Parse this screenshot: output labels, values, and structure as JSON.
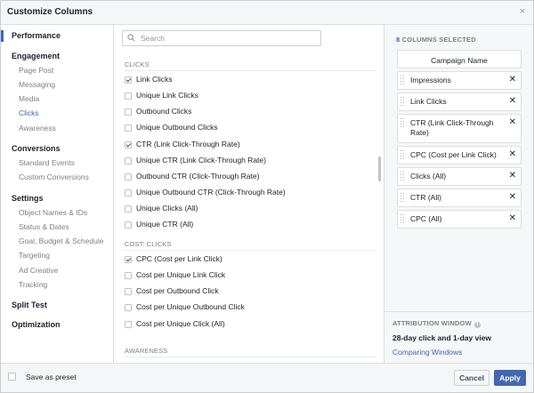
{
  "dialog": {
    "title": "Customize Columns",
    "close_glyph": "×"
  },
  "nav": {
    "sections": [
      {
        "label": "Performance",
        "items": []
      },
      {
        "label": "Engagement",
        "items": [
          "Page Post",
          "Messaging",
          "Media",
          "Clicks",
          "Awareness"
        ]
      },
      {
        "label": "Conversions",
        "items": [
          "Standard Events",
          "Custom Conversions"
        ]
      },
      {
        "label": "Settings",
        "items": [
          "Object Names & IDs",
          "Status & Dates",
          "Goal, Budget & Schedule",
          "Targeting",
          "Ad Creative",
          "Tracking"
        ]
      },
      {
        "label": "Split Test",
        "items": []
      },
      {
        "label": "Optimization",
        "items": []
      }
    ],
    "active_section": "Performance",
    "active_item": "Clicks"
  },
  "search": {
    "placeholder": "Search",
    "value": ""
  },
  "groups": [
    {
      "label": "CLICKS",
      "options": [
        {
          "label": "Link Clicks",
          "checked": true
        },
        {
          "label": "Unique Link Clicks",
          "checked": false
        },
        {
          "label": "Outbound Clicks",
          "checked": false
        },
        {
          "label": "Unique Outbound Clicks",
          "checked": false
        },
        {
          "label": "CTR (Link Click-Through Rate)",
          "checked": true
        },
        {
          "label": "Unique CTR (Link Click-Through Rate)",
          "checked": false
        },
        {
          "label": "Outbound CTR (Click-Through Rate)",
          "checked": false
        },
        {
          "label": "Unique Outbound CTR (Click-Through Rate)",
          "checked": false
        },
        {
          "label": "Unique Clicks (All)",
          "checked": false
        },
        {
          "label": "Unique CTR (All)",
          "checked": false
        }
      ]
    },
    {
      "label": "COST: CLICKS",
      "options": [
        {
          "label": "CPC (Cost per Link Click)",
          "checked": true
        },
        {
          "label": "Cost per Unique Link Click",
          "checked": false
        },
        {
          "label": "Cost per Outbound Click",
          "checked": false
        },
        {
          "label": "Cost per Unique Outbound Click",
          "checked": false
        },
        {
          "label": "Cost per Unique Click (All)",
          "checked": false
        }
      ]
    },
    {
      "label": "AWARENESS",
      "options": []
    }
  ],
  "selected": {
    "count": "8",
    "heading": "COLUMNS SELECTED",
    "items": [
      {
        "label": "Campaign Name",
        "fixed": true
      },
      {
        "label": "Impressions",
        "fixed": false
      },
      {
        "label": "Link Clicks",
        "fixed": false
      },
      {
        "label": "CTR (Link Click-Through Rate)",
        "fixed": false
      },
      {
        "label": "CPC (Cost per Link Click)",
        "fixed": false
      },
      {
        "label": "Clicks (All)",
        "fixed": false
      },
      {
        "label": "CTR (All)",
        "fixed": false
      },
      {
        "label": "CPC (All)",
        "fixed": false
      }
    ],
    "remove_glyph": "✕"
  },
  "attribution": {
    "title": "ATTRIBUTION WINDOW",
    "info_glyph": "i",
    "value": "28-day click and 1-day view",
    "link": "Comparing Windows"
  },
  "footer": {
    "preset_label": "Save as preset",
    "cancel_label": "Cancel",
    "apply_label": "Apply"
  },
  "colors": {
    "accent": "#4267b2",
    "muted": "#7f7f7f",
    "panel_bg": "#f6f7f9"
  }
}
